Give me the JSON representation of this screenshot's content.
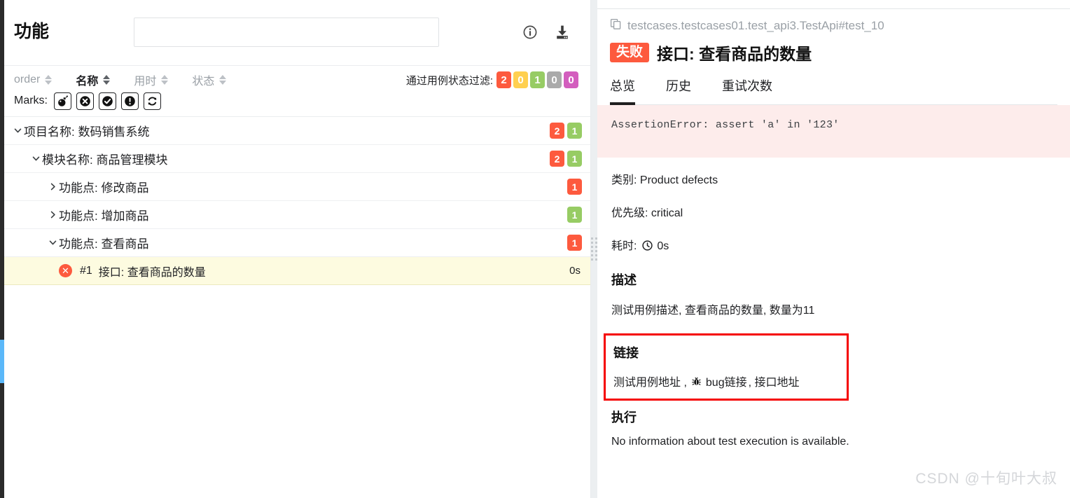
{
  "left": {
    "title": "功能",
    "search": {
      "value": "",
      "placeholder": ""
    },
    "icons": {
      "info": "info-icon",
      "download": "download-icon"
    },
    "sort": [
      {
        "label": "order",
        "active": false
      },
      {
        "label": "名称",
        "active": true
      },
      {
        "label": "用时",
        "active": false
      },
      {
        "label": "状态",
        "active": false
      }
    ],
    "status_filter": {
      "label": "通过用例状态过滤:",
      "badges": [
        {
          "key": "failed",
          "count": "2",
          "color": "#fd5a3e"
        },
        {
          "key": "broken",
          "count": "0",
          "color": "#ffd050"
        },
        {
          "key": "passed",
          "count": "1",
          "color": "#97cc64"
        },
        {
          "key": "skipped",
          "count": "0",
          "color": "#aaaaaa"
        },
        {
          "key": "unknown",
          "count": "0",
          "color": "#d35ebe"
        }
      ]
    },
    "marks": {
      "label": "Marks:",
      "items": [
        "bomb-icon",
        "x-circle-icon",
        "check-circle-icon",
        "exclamation-circle-icon",
        "retry-icon"
      ]
    },
    "tree": [
      {
        "level": 0,
        "chevron": "down",
        "label": "项目名称: 数码销售系统",
        "badges": [
          {
            "type": "failed",
            "count": "2"
          },
          {
            "type": "passed",
            "count": "1"
          }
        ]
      },
      {
        "level": 1,
        "chevron": "down",
        "label": "模块名称: 商品管理模块",
        "badges": [
          {
            "type": "failed",
            "count": "2"
          },
          {
            "type": "passed",
            "count": "1"
          }
        ]
      },
      {
        "level": 2,
        "chevron": "right",
        "label": "功能点: 修改商品",
        "badges": [
          {
            "type": "failed",
            "count": "1"
          }
        ]
      },
      {
        "level": 2,
        "chevron": "right",
        "label": "功能点: 增加商品",
        "badges": [
          {
            "type": "passed",
            "count": "1"
          }
        ]
      },
      {
        "level": 2,
        "chevron": "down",
        "label": "功能点: 查看商品",
        "badges": [
          {
            "type": "failed",
            "count": "1"
          }
        ]
      }
    ],
    "leaf": {
      "status": "failed",
      "number": "#1",
      "name": "接口: 查看商品的数量",
      "duration": "0s"
    }
  },
  "right": {
    "path": "testcases.testcases01.test_api3.TestApi#test_10",
    "status_chip": "失败",
    "title": "接口: 查看商品的数量",
    "tabs": [
      {
        "label": "总览",
        "active": true
      },
      {
        "label": "历史",
        "active": false
      },
      {
        "label": "重试次数",
        "active": false
      }
    ],
    "error": "AssertionError: assert 'a' in '123'",
    "fields": {
      "category": "类别: Product defects",
      "severity": "优先级: critical",
      "duration_label": "耗时:",
      "duration_value": "0s"
    },
    "description": {
      "heading": "描述",
      "text": "测试用例描述, 查看商品的数量, 数量为11"
    },
    "links": {
      "heading": "链接",
      "before": "测试用例地址 , ",
      "bug_label": "bug链接",
      "after": " , 接口地址"
    },
    "execution": {
      "heading": "执行",
      "text": "No information about test execution is available."
    }
  },
  "watermark": "CSDN @十旬叶大叔",
  "accent": {
    "failed": "#fd5a3e",
    "passed": "#97cc64",
    "highlight_border": "#f50000",
    "selected_row": "#fdfbe0"
  }
}
